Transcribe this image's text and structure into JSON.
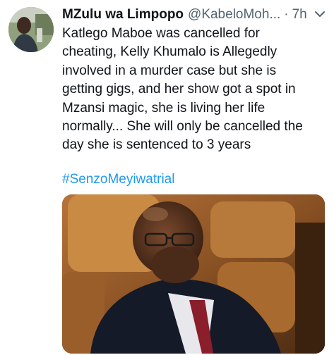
{
  "tweet": {
    "author": {
      "display_name": "MZulu wa Limpopo",
      "handle": "@KabeloMoh...",
      "separator": "·",
      "time": "7h"
    },
    "body_lines": [
      "Katlego Maboe was cancelled for",
      "cheating, Kelly Khumalo is Allegedly",
      "involved in a murder case but she is",
      "getting gigs, and her show got a spot in",
      "Mzansi magic, she is living her life",
      "normally... She will only be cancelled the",
      "day she is sentenced to 3 years"
    ],
    "hashtag": "#SenzoMeyiwatrial",
    "icons": {
      "more": "chevron-down-icon"
    },
    "colors": {
      "text": "#0f1419",
      "secondary": "#536471",
      "link": "#1d9bf0"
    }
  }
}
